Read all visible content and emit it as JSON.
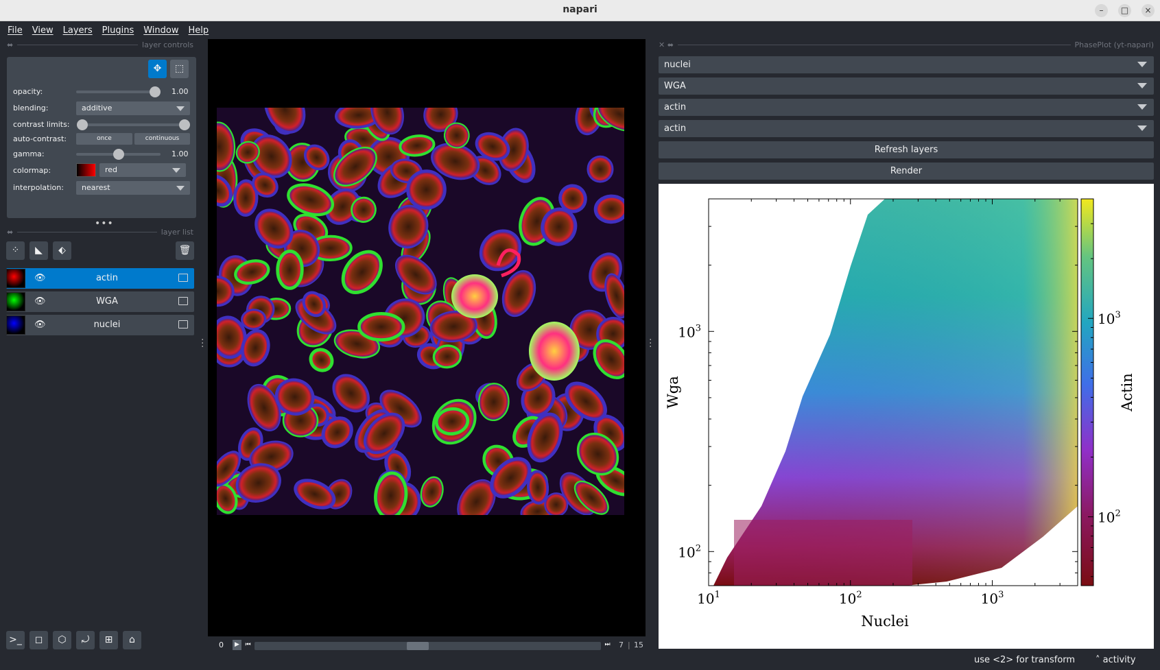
{
  "window": {
    "title": "napari"
  },
  "menu": [
    "File",
    "View",
    "Layers",
    "Plugins",
    "Window",
    "Help"
  ],
  "layer_controls": {
    "header": "layer controls",
    "opacity": {
      "label": "opacity:",
      "value": "1.00",
      "fraction": 1.0
    },
    "blending": {
      "label": "blending:",
      "value": "additive"
    },
    "contrast_limits": {
      "label": "contrast limits:"
    },
    "auto_contrast": {
      "label": "auto-contrast:",
      "once": "once",
      "continuous": "continuous"
    },
    "gamma": {
      "label": "gamma:",
      "value": "1.00",
      "fraction": 0.5
    },
    "colormap": {
      "label": "colormap:",
      "value": "red"
    },
    "interpolation": {
      "label": "interpolation:",
      "value": "nearest"
    }
  },
  "layer_list": {
    "header": "layer list",
    "layers": [
      {
        "name": "actin",
        "selected": true,
        "color": "#ff0000"
      },
      {
        "name": "WGA",
        "selected": false,
        "color": "#00ff00"
      },
      {
        "name": "nuclei",
        "selected": false,
        "color": "#0000ff"
      }
    ]
  },
  "dims": {
    "start": "0",
    "current": "7",
    "total": "15",
    "fraction": 0.47
  },
  "plugin": {
    "header": "PhasePlot (yt-napari)",
    "dropdowns": [
      "nuclei",
      "WGA",
      "actin",
      "actin"
    ],
    "refresh_label": "Refresh layers",
    "render_label": "Render"
  },
  "chart_data": {
    "type": "heatmap",
    "xlabel": "Nuclei",
    "ylabel": "Wga",
    "colorbar_label": "Actin",
    "x_scale": "log",
    "y_scale": "log",
    "xlim": [
      10,
      4000
    ],
    "ylim": [
      70,
      4000
    ],
    "x_ticks": [
      {
        "value": 10,
        "label": "10",
        "exp": "1"
      },
      {
        "value": 100,
        "label": "10",
        "exp": "2"
      },
      {
        "value": 1000,
        "label": "10",
        "exp": "3"
      }
    ],
    "y_ticks": [
      {
        "value": 100,
        "label": "10",
        "exp": "2"
      },
      {
        "value": 1000,
        "label": "10",
        "exp": "3"
      }
    ],
    "colorbar_ticks": [
      {
        "value": 100,
        "label": "10",
        "exp": "2"
      },
      {
        "value": 1000,
        "label": "10",
        "exp": "3"
      }
    ],
    "colorbar_range": [
      45,
      4000
    ],
    "colormap": "viridis-like (dark red → purple → blue → teal → yellow)"
  },
  "status": {
    "hint": "use <2> for transform",
    "activity": "activity"
  }
}
